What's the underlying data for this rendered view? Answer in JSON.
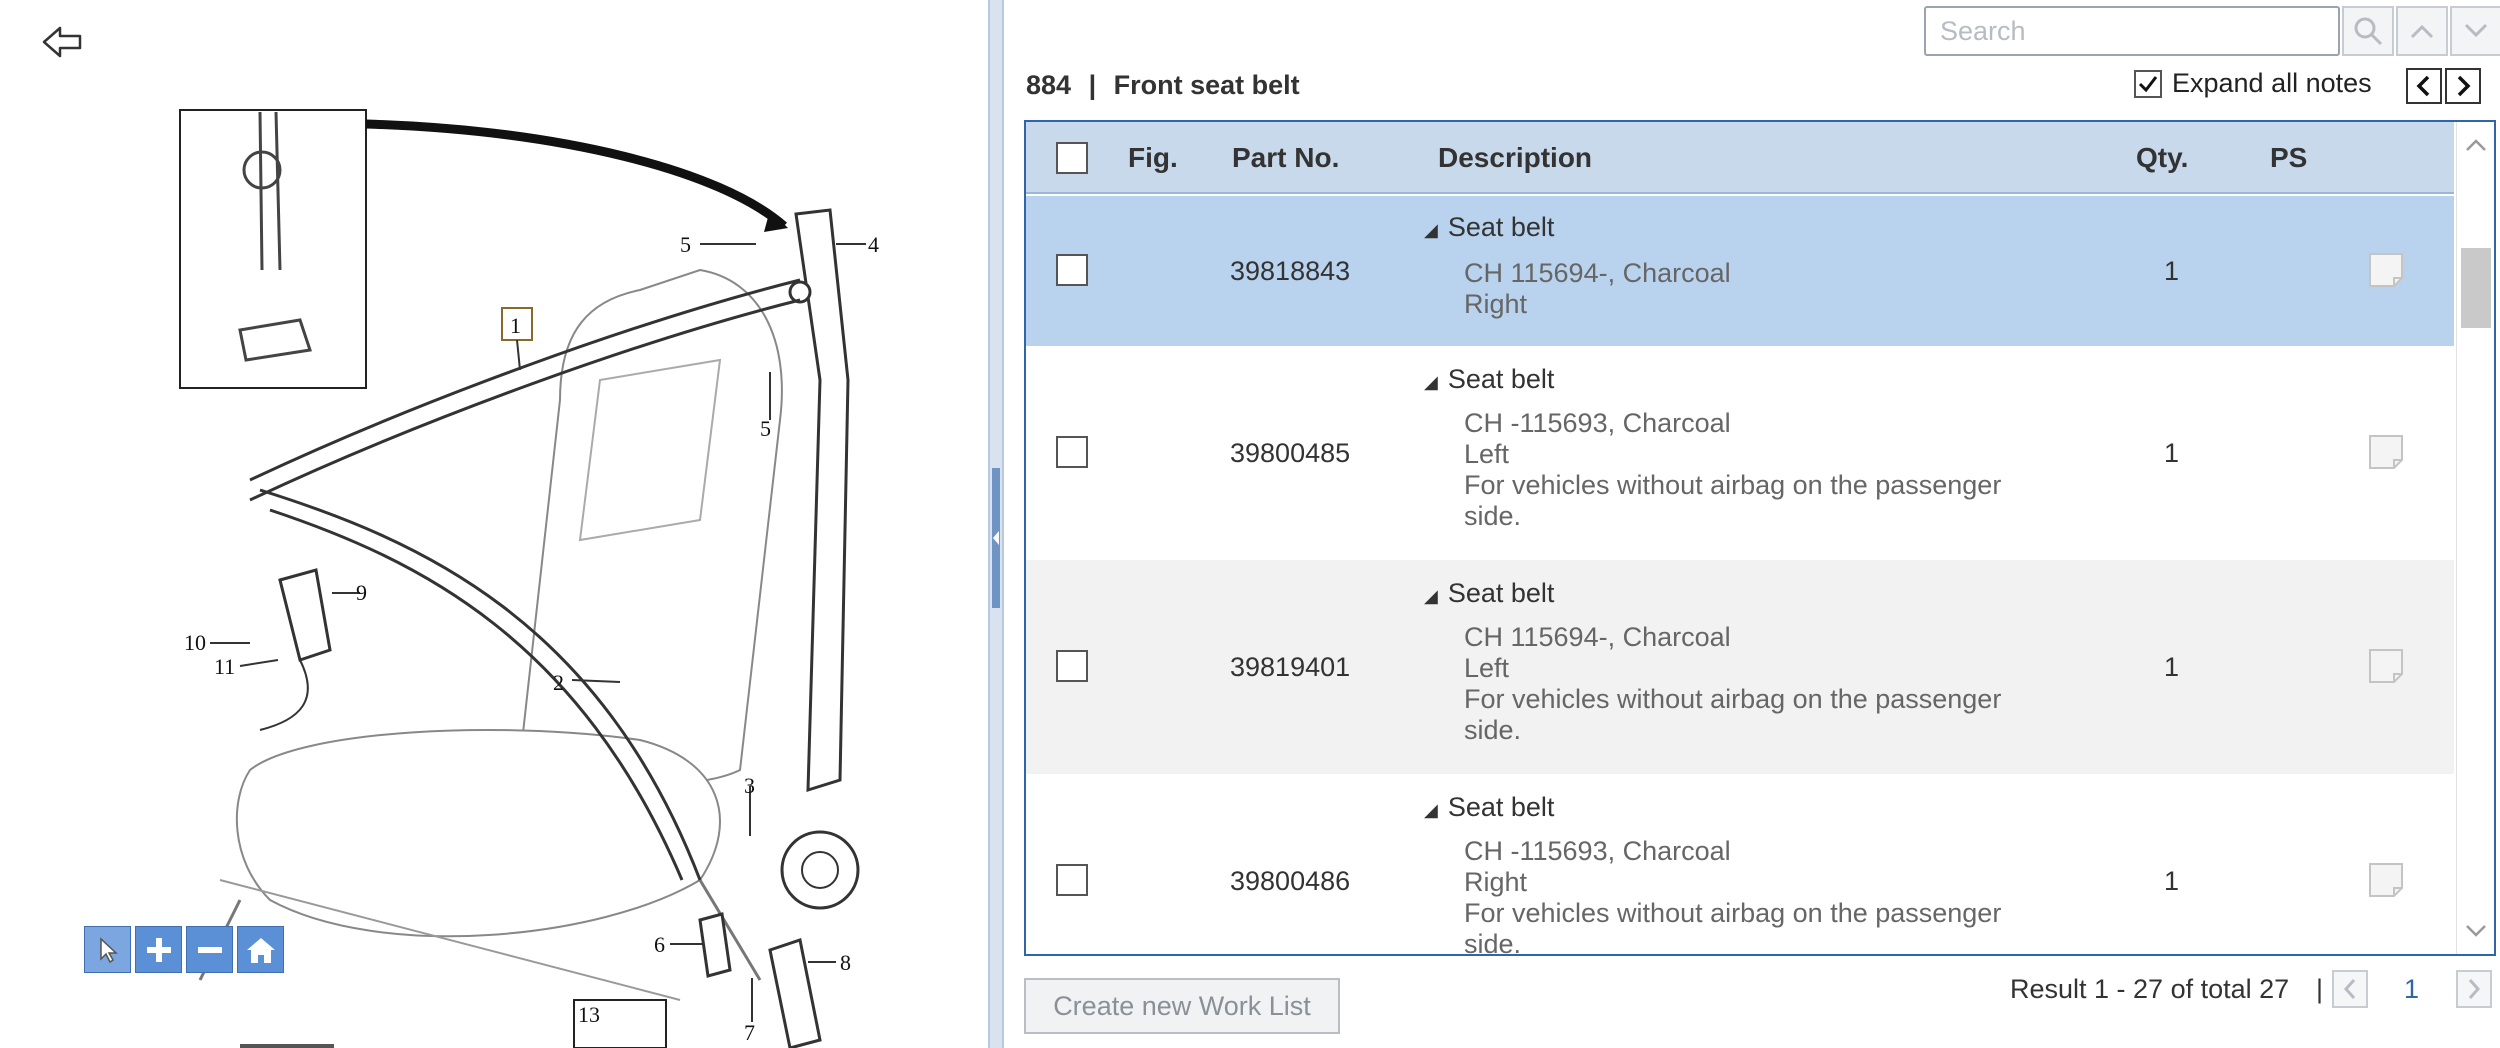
{
  "icons": {
    "back": "back-arrow-icon",
    "search": "search-icon",
    "up": "chevron-up-icon",
    "down": "chevron-down-icon",
    "note": "note-icon",
    "select_tool": "cursor-icon",
    "zoom_in": "plus-icon",
    "zoom_out": "minus-icon",
    "home": "home-icon"
  },
  "search": {
    "placeholder": "Search",
    "value": ""
  },
  "header": {
    "group_no": "884",
    "separator": "|",
    "group_name": "Front seat belt"
  },
  "expand_notes": {
    "label": "Expand all notes",
    "checked": true
  },
  "table": {
    "columns": {
      "fig": "Fig.",
      "part_no": "Part No.",
      "description": "Description",
      "qty": "Qty.",
      "ps": "PS"
    },
    "rows": [
      {
        "fig": "",
        "part_no": "39818843",
        "title": "Seat belt",
        "lines": [
          "CH 115694-, Charcoal",
          "Right"
        ],
        "qty": "1"
      },
      {
        "fig": "",
        "part_no": "39800485",
        "title": "Seat belt",
        "lines": [
          "CH -115693, Charcoal",
          "Left",
          "For vehicles without airbag on the passenger",
          "side."
        ],
        "qty": "1"
      },
      {
        "fig": "",
        "part_no": "39819401",
        "title": "Seat belt",
        "lines": [
          "CH 115694-, Charcoal",
          "Left",
          "For vehicles without airbag on the passenger",
          "side."
        ],
        "qty": "1"
      },
      {
        "fig": "",
        "part_no": "39800486",
        "title": "Seat belt",
        "lines": [
          "CH -115693, Charcoal",
          "Right",
          "For vehicles without airbag on the passenger",
          "side."
        ],
        "qty": "1"
      }
    ]
  },
  "footer": {
    "create_worklist": "Create new Work List",
    "result_text": "Result 1 - 27 of total 27",
    "pipe": "|",
    "page": "1"
  },
  "illustration": {
    "callouts": [
      "1",
      "2",
      "3",
      "4",
      "5",
      "5",
      "6",
      "7",
      "8",
      "9",
      "10",
      "11",
      "13"
    ]
  },
  "colors": {
    "accent": "#2f66a8",
    "header_bg": "#c8d9ec",
    "selected_row": "#b9d3ee",
    "zoom_btn": "#5b8fd6"
  }
}
